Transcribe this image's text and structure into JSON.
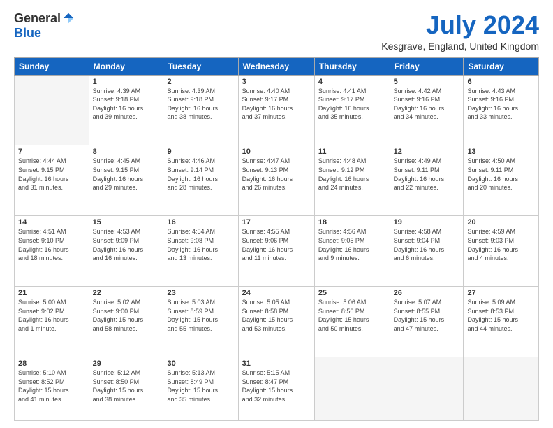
{
  "logo": {
    "general": "General",
    "blue": "Blue"
  },
  "title": "July 2024",
  "location": "Kesgrave, England, United Kingdom",
  "headers": [
    "Sunday",
    "Monday",
    "Tuesday",
    "Wednesday",
    "Thursday",
    "Friday",
    "Saturday"
  ],
  "weeks": [
    [
      {
        "day": "",
        "info": ""
      },
      {
        "day": "1",
        "info": "Sunrise: 4:39 AM\nSunset: 9:18 PM\nDaylight: 16 hours\nand 39 minutes."
      },
      {
        "day": "2",
        "info": "Sunrise: 4:39 AM\nSunset: 9:18 PM\nDaylight: 16 hours\nand 38 minutes."
      },
      {
        "day": "3",
        "info": "Sunrise: 4:40 AM\nSunset: 9:17 PM\nDaylight: 16 hours\nand 37 minutes."
      },
      {
        "day": "4",
        "info": "Sunrise: 4:41 AM\nSunset: 9:17 PM\nDaylight: 16 hours\nand 35 minutes."
      },
      {
        "day": "5",
        "info": "Sunrise: 4:42 AM\nSunset: 9:16 PM\nDaylight: 16 hours\nand 34 minutes."
      },
      {
        "day": "6",
        "info": "Sunrise: 4:43 AM\nSunset: 9:16 PM\nDaylight: 16 hours\nand 33 minutes."
      }
    ],
    [
      {
        "day": "7",
        "info": "Sunrise: 4:44 AM\nSunset: 9:15 PM\nDaylight: 16 hours\nand 31 minutes."
      },
      {
        "day": "8",
        "info": "Sunrise: 4:45 AM\nSunset: 9:15 PM\nDaylight: 16 hours\nand 29 minutes."
      },
      {
        "day": "9",
        "info": "Sunrise: 4:46 AM\nSunset: 9:14 PM\nDaylight: 16 hours\nand 28 minutes."
      },
      {
        "day": "10",
        "info": "Sunrise: 4:47 AM\nSunset: 9:13 PM\nDaylight: 16 hours\nand 26 minutes."
      },
      {
        "day": "11",
        "info": "Sunrise: 4:48 AM\nSunset: 9:12 PM\nDaylight: 16 hours\nand 24 minutes."
      },
      {
        "day": "12",
        "info": "Sunrise: 4:49 AM\nSunset: 9:11 PM\nDaylight: 16 hours\nand 22 minutes."
      },
      {
        "day": "13",
        "info": "Sunrise: 4:50 AM\nSunset: 9:11 PM\nDaylight: 16 hours\nand 20 minutes."
      }
    ],
    [
      {
        "day": "14",
        "info": "Sunrise: 4:51 AM\nSunset: 9:10 PM\nDaylight: 16 hours\nand 18 minutes."
      },
      {
        "day": "15",
        "info": "Sunrise: 4:53 AM\nSunset: 9:09 PM\nDaylight: 16 hours\nand 16 minutes."
      },
      {
        "day": "16",
        "info": "Sunrise: 4:54 AM\nSunset: 9:08 PM\nDaylight: 16 hours\nand 13 minutes."
      },
      {
        "day": "17",
        "info": "Sunrise: 4:55 AM\nSunset: 9:06 PM\nDaylight: 16 hours\nand 11 minutes."
      },
      {
        "day": "18",
        "info": "Sunrise: 4:56 AM\nSunset: 9:05 PM\nDaylight: 16 hours\nand 9 minutes."
      },
      {
        "day": "19",
        "info": "Sunrise: 4:58 AM\nSunset: 9:04 PM\nDaylight: 16 hours\nand 6 minutes."
      },
      {
        "day": "20",
        "info": "Sunrise: 4:59 AM\nSunset: 9:03 PM\nDaylight: 16 hours\nand 4 minutes."
      }
    ],
    [
      {
        "day": "21",
        "info": "Sunrise: 5:00 AM\nSunset: 9:02 PM\nDaylight: 16 hours\nand 1 minute."
      },
      {
        "day": "22",
        "info": "Sunrise: 5:02 AM\nSunset: 9:00 PM\nDaylight: 15 hours\nand 58 minutes."
      },
      {
        "day": "23",
        "info": "Sunrise: 5:03 AM\nSunset: 8:59 PM\nDaylight: 15 hours\nand 55 minutes."
      },
      {
        "day": "24",
        "info": "Sunrise: 5:05 AM\nSunset: 8:58 PM\nDaylight: 15 hours\nand 53 minutes."
      },
      {
        "day": "25",
        "info": "Sunrise: 5:06 AM\nSunset: 8:56 PM\nDaylight: 15 hours\nand 50 minutes."
      },
      {
        "day": "26",
        "info": "Sunrise: 5:07 AM\nSunset: 8:55 PM\nDaylight: 15 hours\nand 47 minutes."
      },
      {
        "day": "27",
        "info": "Sunrise: 5:09 AM\nSunset: 8:53 PM\nDaylight: 15 hours\nand 44 minutes."
      }
    ],
    [
      {
        "day": "28",
        "info": "Sunrise: 5:10 AM\nSunset: 8:52 PM\nDaylight: 15 hours\nand 41 minutes."
      },
      {
        "day": "29",
        "info": "Sunrise: 5:12 AM\nSunset: 8:50 PM\nDaylight: 15 hours\nand 38 minutes."
      },
      {
        "day": "30",
        "info": "Sunrise: 5:13 AM\nSunset: 8:49 PM\nDaylight: 15 hours\nand 35 minutes."
      },
      {
        "day": "31",
        "info": "Sunrise: 5:15 AM\nSunset: 8:47 PM\nDaylight: 15 hours\nand 32 minutes."
      },
      {
        "day": "",
        "info": ""
      },
      {
        "day": "",
        "info": ""
      },
      {
        "day": "",
        "info": ""
      }
    ]
  ]
}
